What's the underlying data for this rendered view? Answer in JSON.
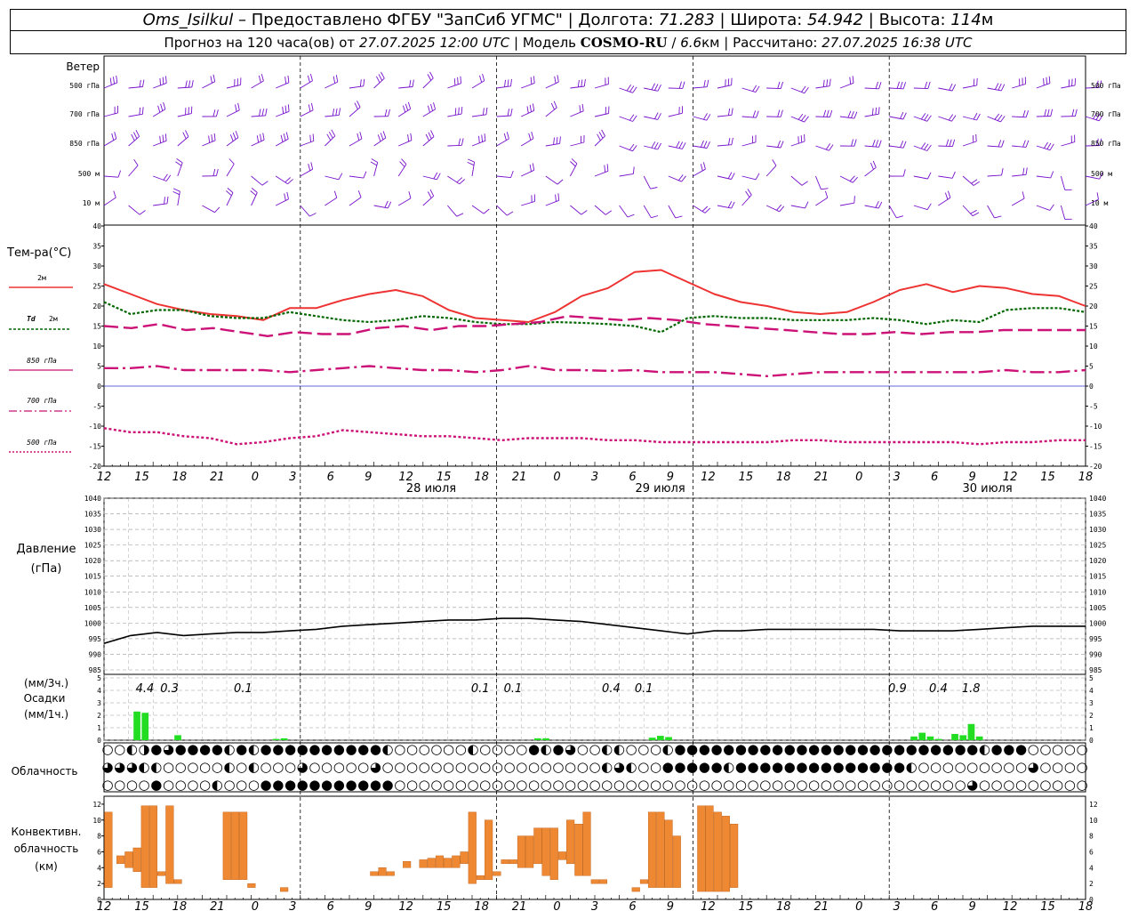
{
  "header": {
    "station": "Oms_Isilkul",
    "dash": " – ",
    "provider": "Предоставлено ФГБУ \"ЗапСиб УГМС\"",
    "lon_label": "Долгота:",
    "lon": "71.283",
    "lat_label": "Широта:",
    "lat": "54.942",
    "alt_label": "Высота:",
    "alt": "114",
    "alt_unit": "м",
    "forecast_label": "Прогноз на 120 часа(ов) от",
    "forecast_start": "27.07.2025 12:00 UTC",
    "model_label": "Модель",
    "model": "COSMO-RU",
    "resolution": "6.6",
    "resolution_unit": "км",
    "computed_label": "Рассчитано:",
    "computed": "27.07.2025 16:38 UTC",
    "sep": "|",
    "slash": "/"
  },
  "labels": {
    "wind": "Ветер",
    "wind_levels": [
      "500 гПа",
      "700 гПа",
      "850 гПа",
      "500 м",
      "10 м"
    ],
    "temp": "Тем-ра(°С)",
    "temp_2m": "2м",
    "td": "Td",
    "td_2m": "2м",
    "t850": "850 гПа",
    "t700": "700 гПа",
    "t500": "500 гПа",
    "pressure": "Давление",
    "pressure_unit": "(гПа)",
    "precip_3h": "(мм/3ч.)",
    "precip": "Осадки",
    "precip_1h": "(мм/1ч.)",
    "clouds": "Облачность",
    "conv1": "Конвективн.",
    "conv2": "облачность",
    "conv3": "(км)"
  },
  "colors": {
    "t2m": "#ee3333",
    "td": "#006600",
    "t850": "#cc1177",
    "t700": "#cc1177",
    "t500": "#cc1177",
    "wind": "#7711cc",
    "precip": "#22dd22",
    "conv": "#ee8833",
    "zero_line": "#3333cc"
  },
  "chart_data": [
    {
      "type": "line",
      "title": "Тем-ра(°С)",
      "x_hours_ticks": [
        "12",
        "15",
        "18",
        "21",
        "0",
        "3",
        "6",
        "9",
        "12",
        "15",
        "18",
        "21",
        "0",
        "3",
        "6",
        "9",
        "12",
        "15",
        "18",
        "21",
        "0",
        "3",
        "6",
        "9",
        "12",
        "15",
        "18"
      ],
      "day_labels": [
        "28 июля",
        "29 июля",
        "30 июля"
      ],
      "ylim": [
        -20,
        40
      ],
      "yticks": [
        "40",
        "35",
        "30",
        "25",
        "20",
        "15",
        "10",
        "5",
        "0",
        "-5",
        "-10",
        "-15",
        "-20"
      ],
      "grid": false,
      "x_hours": [
        0,
        3,
        6,
        9,
        12,
        15,
        18,
        21,
        24,
        27,
        30,
        33,
        36,
        39,
        42,
        45,
        48,
        51,
        54,
        57,
        60,
        63,
        66,
        69,
        72,
        75,
        78,
        81,
        84,
        87,
        90,
        93,
        96,
        99,
        102,
        105,
        108,
        111,
        114,
        117,
        120
      ],
      "series": [
        {
          "name": "2м",
          "values": [
            25.5,
            23,
            20.5,
            19,
            18,
            17.5,
            16.5,
            19.5,
            19.5,
            21.5,
            23,
            24,
            22.5,
            19,
            17,
            16.5,
            16,
            18.5,
            22.5,
            24.5,
            28.5,
            29,
            26,
            23,
            21,
            20,
            18.5,
            18,
            18.5,
            21,
            24,
            25.5,
            23.5,
            25,
            24.5,
            23,
            22.5,
            20
          ]
        },
        {
          "name": "Td 2м",
          "values": [
            21,
            18,
            19,
            19,
            17.5,
            17,
            17,
            18.5,
            17.5,
            16.5,
            16,
            16.5,
            17.5,
            17,
            16,
            15.5,
            15.5,
            16,
            15.8,
            15.5,
            15,
            13.5,
            17,
            17.5,
            17,
            17,
            16.5,
            16.5,
            16.5,
            17,
            16.5,
            15.5,
            16.5,
            16,
            19,
            19.5,
            19.5,
            18.5
          ]
        },
        {
          "name": "850 гПа",
          "values": [
            15,
            14.5,
            15.5,
            14,
            14.5,
            13.5,
            12.5,
            13.5,
            13,
            13,
            14.5,
            15,
            14,
            15,
            15,
            15.5,
            16,
            17.5,
            17,
            16.5,
            17,
            16.5,
            15.5,
            15,
            14.5,
            14,
            13.5,
            13,
            13,
            13.5,
            13,
            13.5,
            13.5,
            14,
            14,
            14,
            14
          ]
        },
        {
          "name": "700 гПа",
          "values": [
            4.5,
            4.5,
            5,
            4,
            4,
            4,
            4,
            3.5,
            4,
            4.5,
            5,
            4.5,
            4,
            4,
            3.5,
            4,
            5,
            4,
            4,
            3.8,
            4,
            3.5,
            3.5,
            3.5,
            3,
            2.5,
            3,
            3.5,
            3.5,
            3.5,
            3.5,
            3.5,
            3.5,
            3.5,
            4,
            3.5,
            3.5,
            4
          ]
        },
        {
          "name": "500 гПа",
          "values": [
            -10.5,
            -11.5,
            -11.5,
            -12.5,
            -13,
            -14.5,
            -14,
            -13,
            -12.5,
            -11,
            -11.5,
            -12,
            -12.5,
            -12.5,
            -13,
            -13.5,
            -13,
            -13,
            -13,
            -13.5,
            -13.5,
            -14,
            -14,
            -14,
            -14,
            -14,
            -13.5,
            -13.5,
            -14,
            -14,
            -14,
            -14,
            -14,
            -14.5,
            -14,
            -14,
            -13.5,
            -13.5
          ]
        }
      ]
    },
    {
      "type": "line",
      "title": "Давление (гПа)",
      "ylim": [
        985,
        1040
      ],
      "yticks": [
        "1040",
        "1035",
        "1030",
        "1025",
        "1020",
        "1015",
        "1010",
        "1005",
        "1000",
        "995",
        "990",
        "985"
      ],
      "grid": true,
      "series": [
        {
          "name": "Давление",
          "values": [
            993.5,
            996,
            997,
            996,
            996.5,
            997,
            997,
            997.5,
            998,
            999,
            999.5,
            1000,
            1000.5,
            1001,
            1001,
            1001.5,
            1001.5,
            1001,
            1000.5,
            999.5,
            998.5,
            997.5,
            996.5,
            997.5,
            997.5,
            998,
            998,
            998,
            998,
            998,
            997.5,
            997.5,
            997.5,
            998,
            998.5,
            999,
            999,
            999
          ]
        }
      ]
    },
    {
      "type": "bar",
      "title": "Осадки (мм/1ч.)",
      "ylim": [
        0,
        5
      ],
      "yticks": [
        "5",
        "4",
        "3",
        "2",
        "1",
        "0"
      ],
      "grid": true,
      "labels_3h": [
        {
          "x_hour": 5,
          "text": "4.4"
        },
        {
          "x_hour": 8,
          "text": "0.3"
        },
        {
          "x_hour": 17,
          "text": "0.1"
        },
        {
          "x_hour": 46,
          "text": "0.1"
        },
        {
          "x_hour": 50,
          "text": "0.1"
        },
        {
          "x_hour": 62,
          "text": "0.4"
        },
        {
          "x_hour": 66,
          "text": "0.1"
        },
        {
          "x_hour": 97,
          "text": "0.9"
        },
        {
          "x_hour": 102,
          "text": "0.4"
        },
        {
          "x_hour": 106,
          "text": "1.8"
        }
      ],
      "bars": [
        {
          "x_hour": 4,
          "value": 2.3
        },
        {
          "x_hour": 5,
          "value": 2.2
        },
        {
          "x_hour": 9,
          "value": 0.4
        },
        {
          "x_hour": 21,
          "value": 0.1
        },
        {
          "x_hour": 22,
          "value": 0.15
        },
        {
          "x_hour": 53,
          "value": 0.15
        },
        {
          "x_hour": 54,
          "value": 0.15
        },
        {
          "x_hour": 67,
          "value": 0.2
        },
        {
          "x_hour": 68,
          "value": 0.35
        },
        {
          "x_hour": 69,
          "value": 0.25
        },
        {
          "x_hour": 99,
          "value": 0.3
        },
        {
          "x_hour": 100,
          "value": 0.6
        },
        {
          "x_hour": 101,
          "value": 0.3
        },
        {
          "x_hour": 102,
          "value": 0.1
        },
        {
          "x_hour": 104,
          "value": 0.5
        },
        {
          "x_hour": 105,
          "value": 0.4
        },
        {
          "x_hour": 106,
          "value": 1.3
        },
        {
          "x_hour": 107,
          "value": 0.3
        }
      ]
    },
    {
      "type": "bar",
      "title": "Конвективн. облачность (км)",
      "ylim": [
        0,
        13
      ],
      "yticks": [
        "12",
        "10",
        "8",
        "6",
        "4",
        "2",
        "0"
      ],
      "grid": false,
      "bars": [
        {
          "x_hour": 0.5,
          "bottom": 1.5,
          "top": 11
        },
        {
          "x_hour": 2,
          "bottom": 4.5,
          "top": 5.5
        },
        {
          "x_hour": 3,
          "bottom": 4,
          "top": 6
        },
        {
          "x_hour": 4,
          "bottom": 3.5,
          "top": 6.5
        },
        {
          "x_hour": 5,
          "bottom": 1.5,
          "top": 11.8
        },
        {
          "x_hour": 6,
          "bottom": 1.5,
          "top": 11.8
        },
        {
          "x_hour": 7,
          "bottom": 3,
          "top": 3.5
        },
        {
          "x_hour": 8,
          "bottom": 2,
          "top": 11.8
        },
        {
          "x_hour": 9,
          "bottom": 2,
          "top": 2.5
        },
        {
          "x_hour": 15,
          "bottom": 2.5,
          "top": 11
        },
        {
          "x_hour": 16,
          "bottom": 2.5,
          "top": 11
        },
        {
          "x_hour": 17,
          "bottom": 2.5,
          "top": 11
        },
        {
          "x_hour": 18,
          "bottom": 1.5,
          "top": 2
        },
        {
          "x_hour": 22,
          "bottom": 1,
          "top": 1.5
        },
        {
          "x_hour": 33,
          "bottom": 3,
          "top": 3.5
        },
        {
          "x_hour": 34,
          "bottom": 3,
          "top": 4
        },
        {
          "x_hour": 35,
          "bottom": 3,
          "top": 3.5
        },
        {
          "x_hour": 37,
          "bottom": 4,
          "top": 4.8
        },
        {
          "x_hour": 39,
          "bottom": 4,
          "top": 5
        },
        {
          "x_hour": 40,
          "bottom": 4,
          "top": 5.2
        },
        {
          "x_hour": 41,
          "bottom": 4,
          "top": 5.5
        },
        {
          "x_hour": 42,
          "bottom": 4,
          "top": 5.2
        },
        {
          "x_hour": 43,
          "bottom": 4,
          "top": 5.5
        },
        {
          "x_hour": 44,
          "bottom": 4.5,
          "top": 6
        },
        {
          "x_hour": 45,
          "bottom": 2,
          "top": 11
        },
        {
          "x_hour": 46,
          "bottom": 2.5,
          "top": 3
        },
        {
          "x_hour": 47,
          "bottom": 2.5,
          "top": 10
        },
        {
          "x_hour": 48,
          "bottom": 3,
          "top": 3.5
        },
        {
          "x_hour": 49,
          "bottom": 4.5,
          "top": 5
        },
        {
          "x_hour": 50,
          "bottom": 4.5,
          "top": 5
        },
        {
          "x_hour": 51,
          "bottom": 4,
          "top": 8
        },
        {
          "x_hour": 52,
          "bottom": 4,
          "top": 8
        },
        {
          "x_hour": 53,
          "bottom": 4.5,
          "top": 9
        },
        {
          "x_hour": 54,
          "bottom": 3,
          "top": 9
        },
        {
          "x_hour": 55,
          "bottom": 2.5,
          "top": 9
        },
        {
          "x_hour": 56,
          "bottom": 5,
          "top": 6
        },
        {
          "x_hour": 57,
          "bottom": 4.5,
          "top": 10
        },
        {
          "x_hour": 58,
          "bottom": 3,
          "top": 9.5
        },
        {
          "x_hour": 59,
          "bottom": 3,
          "top": 11
        },
        {
          "x_hour": 60,
          "bottom": 2,
          "top": 2.5
        },
        {
          "x_hour": 61,
          "bottom": 2,
          "top": 2.5
        },
        {
          "x_hour": 65,
          "bottom": 1,
          "top": 1.5
        },
        {
          "x_hour": 66,
          "bottom": 2,
          "top": 2.5
        },
        {
          "x_hour": 67,
          "bottom": 1.5,
          "top": 11
        },
        {
          "x_hour": 68,
          "bottom": 1.5,
          "top": 11
        },
        {
          "x_hour": 69,
          "bottom": 1.5,
          "top": 10
        },
        {
          "x_hour": 70,
          "bottom": 1.5,
          "top": 8
        },
        {
          "x_hour": 73,
          "bottom": 1,
          "top": 11.8
        },
        {
          "x_hour": 74,
          "bottom": 1,
          "top": 11.8
        },
        {
          "x_hour": 75,
          "bottom": 1,
          "top": 11
        },
        {
          "x_hour": 76,
          "bottom": 1,
          "top": 10.5
        },
        {
          "x_hour": 77,
          "bottom": 1.5,
          "top": 9.5
        }
      ]
    }
  ],
  "cloud_rows": {
    "symbols": [
      "○",
      "◐",
      "◕",
      "●",
      "⦶",
      "◑"
    ],
    "row1": "○○◐◑●◕●●●●◐●◐●●●●●●●●●●◐○○○○○○◐○○○○●◐●◕○○◐◐○○○◐●●●●●●●●●●●●●●●●●●●●●●●●●◐●●●○○○○○○○●●●●●●◑◑◑◑●●",
    "row2": "◕◕◕◐◐○○○○○◐○◐○○○◕○○○○○◕○○○○○○○○○○○○○○○○○○◐◕◐○○●●●●●◐●●●●●●●●●●●●●●◐○○○○○○○○○◕○○○○○○○○○○○○○○○○○○◐",
    "row3": "○○○○●○○○○◐○○○●●●●●●●●●●●○○○○○○○○○○○○○○○○○○○○○○○○○○○○○○○○○○○○○○○○○○○○○○○◕○○○○○○○○○○○○○○○○○○○○"
  }
}
